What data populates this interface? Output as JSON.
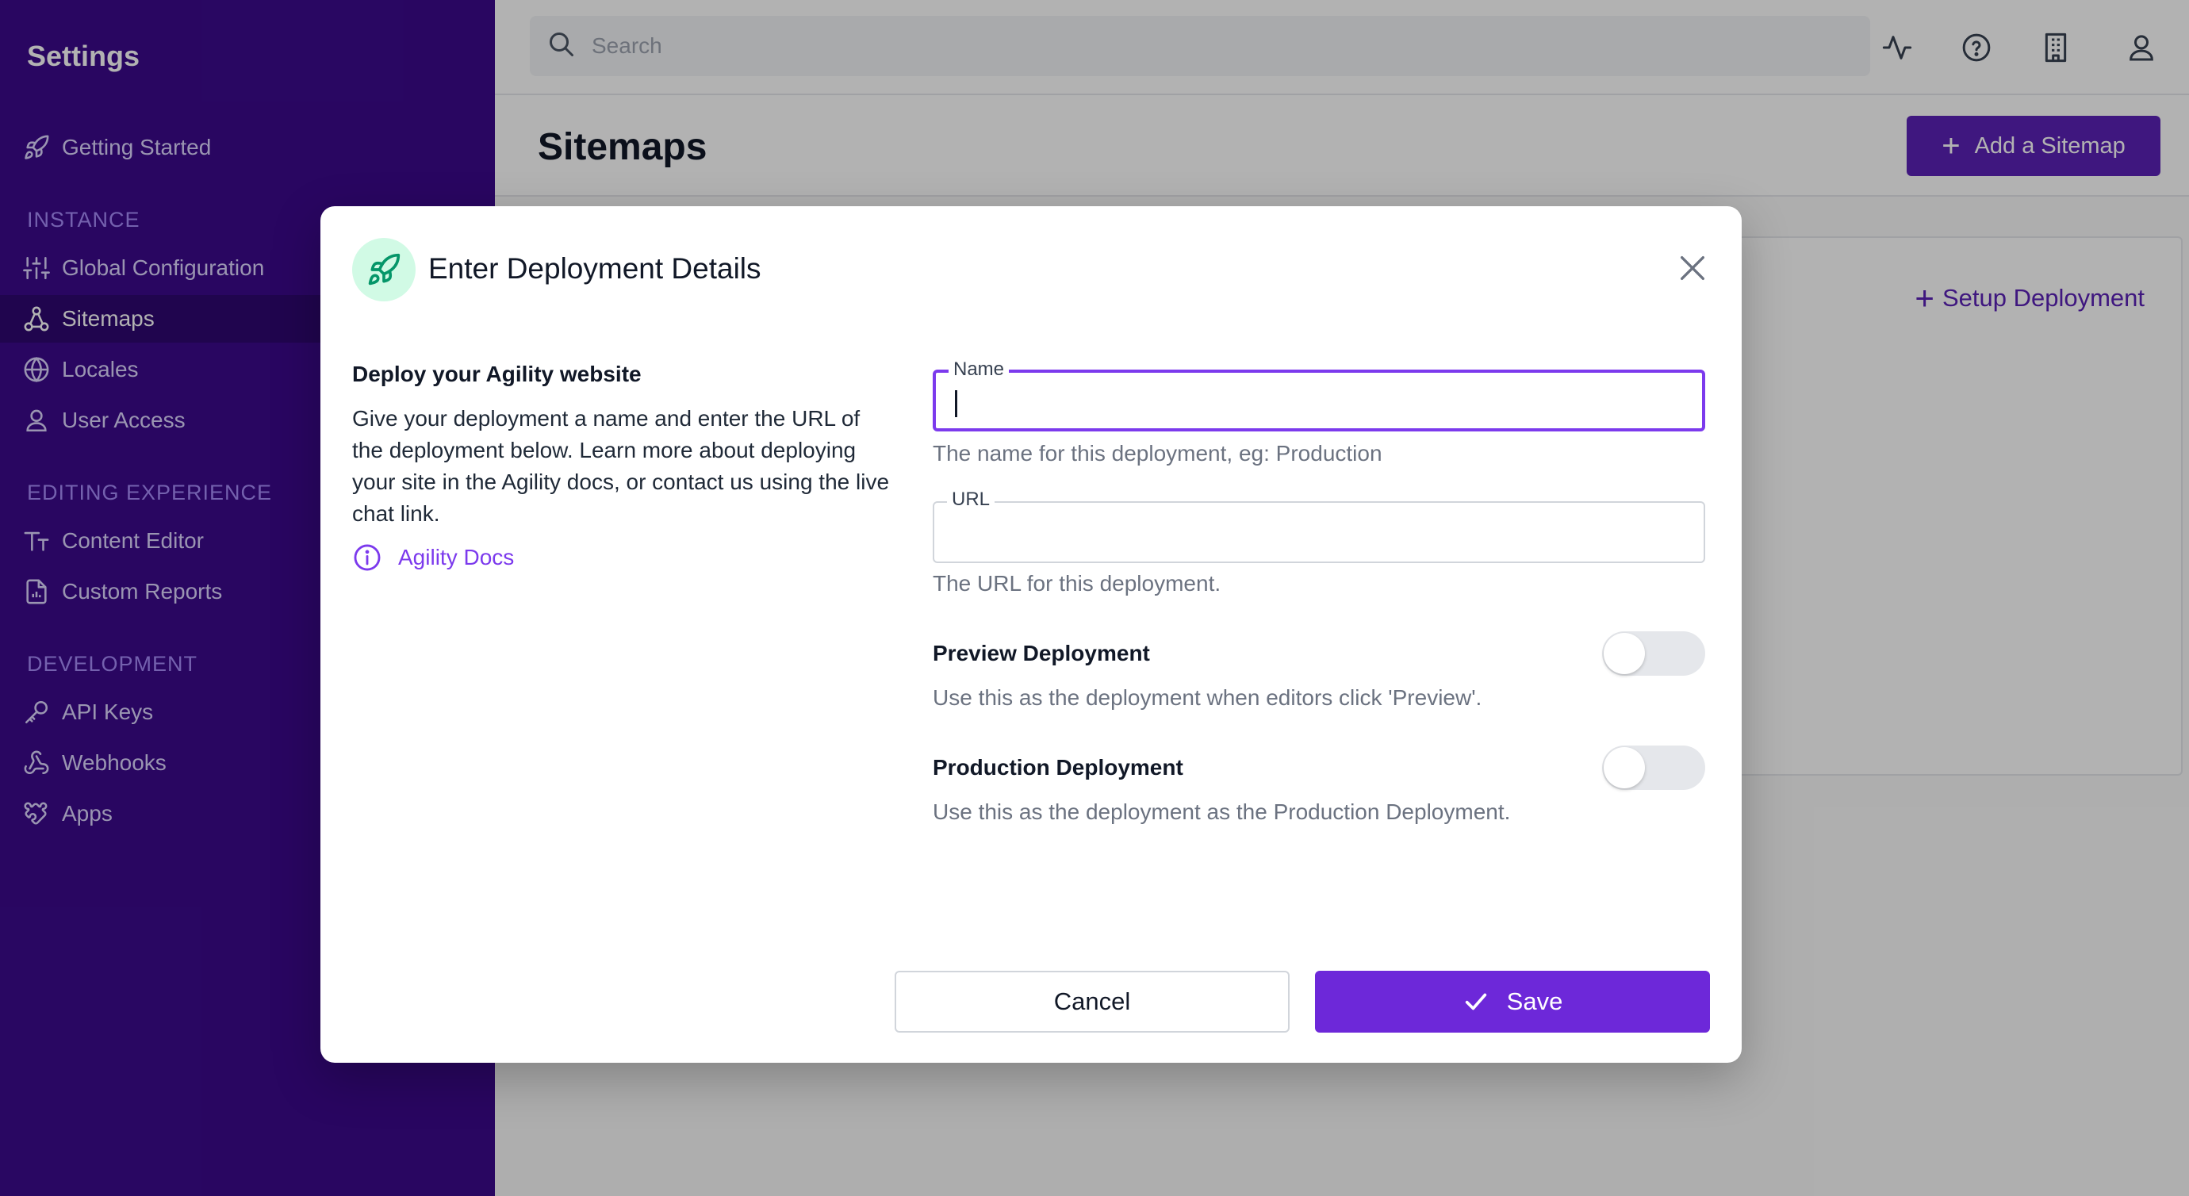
{
  "sidebar": {
    "title": "Settings",
    "top_items": [
      {
        "label": "Getting Started",
        "icon": "rocket-icon"
      }
    ],
    "sections": [
      {
        "label": "INSTANCE",
        "items": [
          {
            "label": "Global Configuration",
            "icon": "sliders-icon"
          },
          {
            "label": "Sitemaps",
            "icon": "sitemap-icon",
            "active": true
          },
          {
            "label": "Locales",
            "icon": "globe-icon"
          },
          {
            "label": "User Access",
            "icon": "user-icon"
          }
        ]
      },
      {
        "label": "EDITING EXPERIENCE",
        "items": [
          {
            "label": "Content Editor",
            "icon": "text-format-icon"
          },
          {
            "label": "Custom Reports",
            "icon": "report-icon"
          }
        ]
      },
      {
        "label": "DEVELOPMENT",
        "items": [
          {
            "label": "API Keys",
            "icon": "key-icon"
          },
          {
            "label": "Webhooks",
            "icon": "webhook-icon"
          },
          {
            "label": "Apps",
            "icon": "puzzle-icon"
          }
        ]
      }
    ]
  },
  "topbar": {
    "search_placeholder": "Search",
    "icons": [
      "activity-icon",
      "help-icon",
      "building-icon",
      "user-icon"
    ]
  },
  "page": {
    "title": "Sitemaps",
    "add_button": "Add a Sitemap",
    "setup_link": "Setup Deployment"
  },
  "modal": {
    "title": "Enter Deployment Details",
    "left_heading": "Deploy your Agility website",
    "left_description": "Give your deployment a name and enter the URL of the deployment below. Learn more about deploying your site in the Agility docs, or contact us using the live chat link.",
    "docs_link": "Agility Docs",
    "name_field": {
      "label": "Name",
      "value": "",
      "hint": "The name for this deployment, eg: Production"
    },
    "url_field": {
      "label": "URL",
      "value": "",
      "hint": "The URL for this deployment."
    },
    "preview_toggle": {
      "label": "Preview Deployment",
      "description": "Use this as the deployment when editors click 'Preview'.",
      "on": false
    },
    "production_toggle": {
      "label": "Production Deployment",
      "description": "Use this as the deployment as the Production Deployment.",
      "on": false
    },
    "cancel_label": "Cancel",
    "save_label": "Save"
  },
  "colors": {
    "sidebar_bg": "#3b0a8c",
    "accent": "#6d28d9",
    "modal_icon_bg": "#d1fae5",
    "modal_icon_fg": "#059669"
  }
}
